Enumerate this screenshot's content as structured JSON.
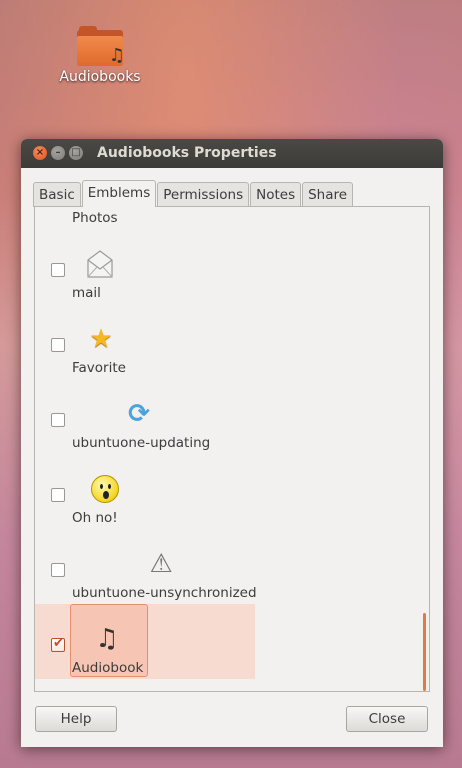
{
  "desktop": {
    "icon_label": "Audiobooks"
  },
  "window": {
    "title": "Audiobooks Properties",
    "tabs": [
      {
        "label": "Basic",
        "active": false
      },
      {
        "label": "Emblems",
        "active": true
      },
      {
        "label": "Permissions",
        "active": false
      },
      {
        "label": "Notes",
        "active": false
      },
      {
        "label": "Share",
        "active": false
      }
    ],
    "emblems": [
      {
        "label": "Photos",
        "checked": false,
        "icon": "photos-icon"
      },
      {
        "label": "mail",
        "checked": false,
        "icon": "mail-icon"
      },
      {
        "label": "Favorite",
        "checked": false,
        "icon": "star-icon"
      },
      {
        "label": "ubuntuone-updating",
        "checked": false,
        "icon": "sync-icon"
      },
      {
        "label": "Oh no!",
        "checked": false,
        "icon": "surprised-face-icon"
      },
      {
        "label": "ubuntuone-unsynchronized",
        "checked": false,
        "icon": "unsync-warning-icon"
      },
      {
        "label": "Audiobook",
        "checked": true,
        "icon": "audiobook-icon"
      }
    ],
    "buttons": {
      "help": "Help",
      "close": "Close"
    }
  },
  "colors": {
    "accent": "#e17b45",
    "titlebar": "#3c3b37",
    "selection": "#f7c5b4"
  }
}
